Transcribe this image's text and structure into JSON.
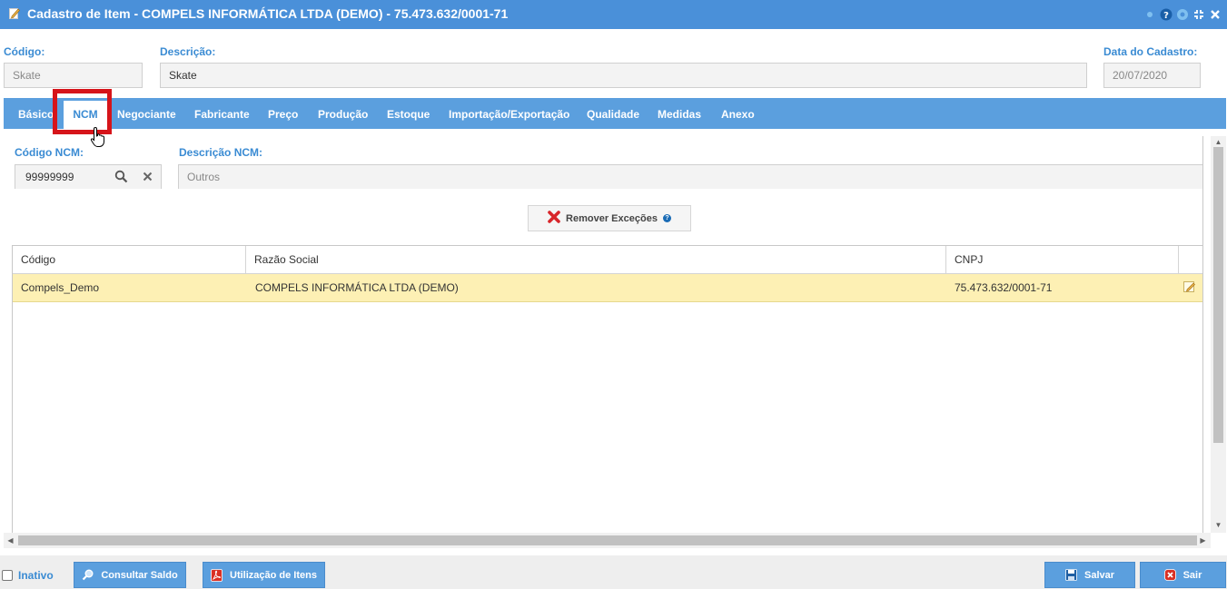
{
  "window": {
    "title": "Cadastro de Item - COMPELS INFORMÁTICA LTDA (DEMO) - 75.473.632/0001-71",
    "controls": [
      "minimize-icon",
      "help-icon",
      "settings-icon",
      "restore-icon",
      "close-icon"
    ]
  },
  "header": {
    "codigo_label": "Código:",
    "codigo_value": "Skate",
    "descricao_label": "Descrição:",
    "descricao_value": "Skate",
    "data_label": "Data do Cadastro:",
    "data_value": "20/07/2020"
  },
  "tabs": [
    {
      "label": "Básico"
    },
    {
      "label": "NCM"
    },
    {
      "label": "Negociante"
    },
    {
      "label": "Fabricante"
    },
    {
      "label": "Preço"
    },
    {
      "label": "Produção"
    },
    {
      "label": "Estoque"
    },
    {
      "label": "Importação/Exportação"
    },
    {
      "label": "Qualidade"
    },
    {
      "label": "Medidas"
    },
    {
      "label": "Anexo"
    }
  ],
  "active_tab": "NCM",
  "ncm": {
    "codigo_label": "Código NCM:",
    "codigo_value": "99999999",
    "descricao_label": "Descrição NCM:",
    "descricao_value": "Outros",
    "remove_button": "Remover Exceções"
  },
  "grid": {
    "columns": [
      "Código",
      "Razão Social",
      "CNPJ"
    ],
    "rows": [
      {
        "codigo": "Compels_Demo",
        "razao_social": "COMPELS INFORMÁTICA LTDA (DEMO)",
        "cnpj": "75.473.632/0001-71"
      }
    ]
  },
  "footer": {
    "inativo_label": "Inativo",
    "consultar_saldo": "Consultar Saldo",
    "utilizacao_itens": "Utilização de Itens",
    "salvar": "Salvar",
    "sair": "Sair"
  },
  "colors": {
    "accent": "#5b9fde",
    "title_bar": "#4a90d9",
    "label": "#3a8bd3",
    "selected_row": "#fdf0b4",
    "highlight": "#d6141a"
  }
}
